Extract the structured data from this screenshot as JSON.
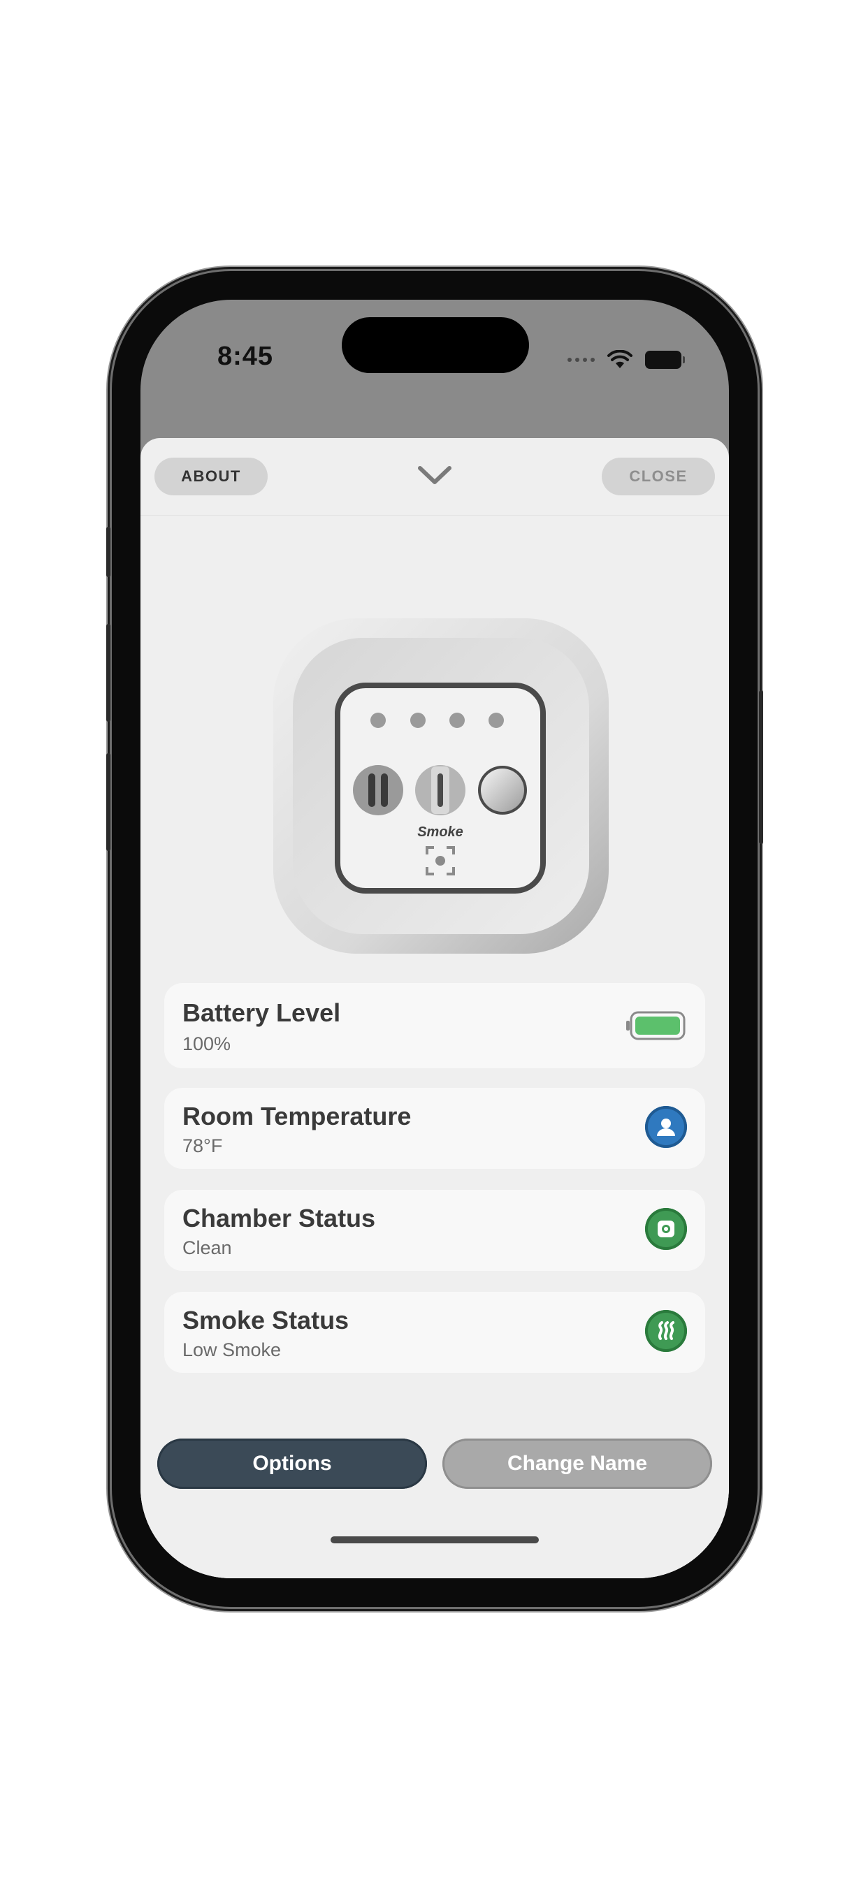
{
  "status_bar": {
    "time": "8:45"
  },
  "header": {
    "about_label": "ABOUT",
    "close_label": "CLOSE"
  },
  "device": {
    "label": "Smoke"
  },
  "status_cards": [
    {
      "title": "Battery Level",
      "value": "100%",
      "icon": "battery-full-icon",
      "accent": "#5cc06c"
    },
    {
      "title": "Room Temperature",
      "value": "78°F",
      "icon": "person-icon",
      "accent": "#2f79bf"
    },
    {
      "title": "Chamber Status",
      "value": "Clean",
      "icon": "chamber-icon",
      "accent": "#3f9a54"
    },
    {
      "title": "Smoke Status",
      "value": "Low Smoke",
      "icon": "smoke-icon",
      "accent": "#3f9a54"
    }
  ],
  "footer": {
    "options_label": "Options",
    "change_name_label": "Change Name"
  },
  "colors": {
    "primary_button": "#3b4a57",
    "secondary_button": "#a9a9a9",
    "sheet_background": "#efefef"
  }
}
